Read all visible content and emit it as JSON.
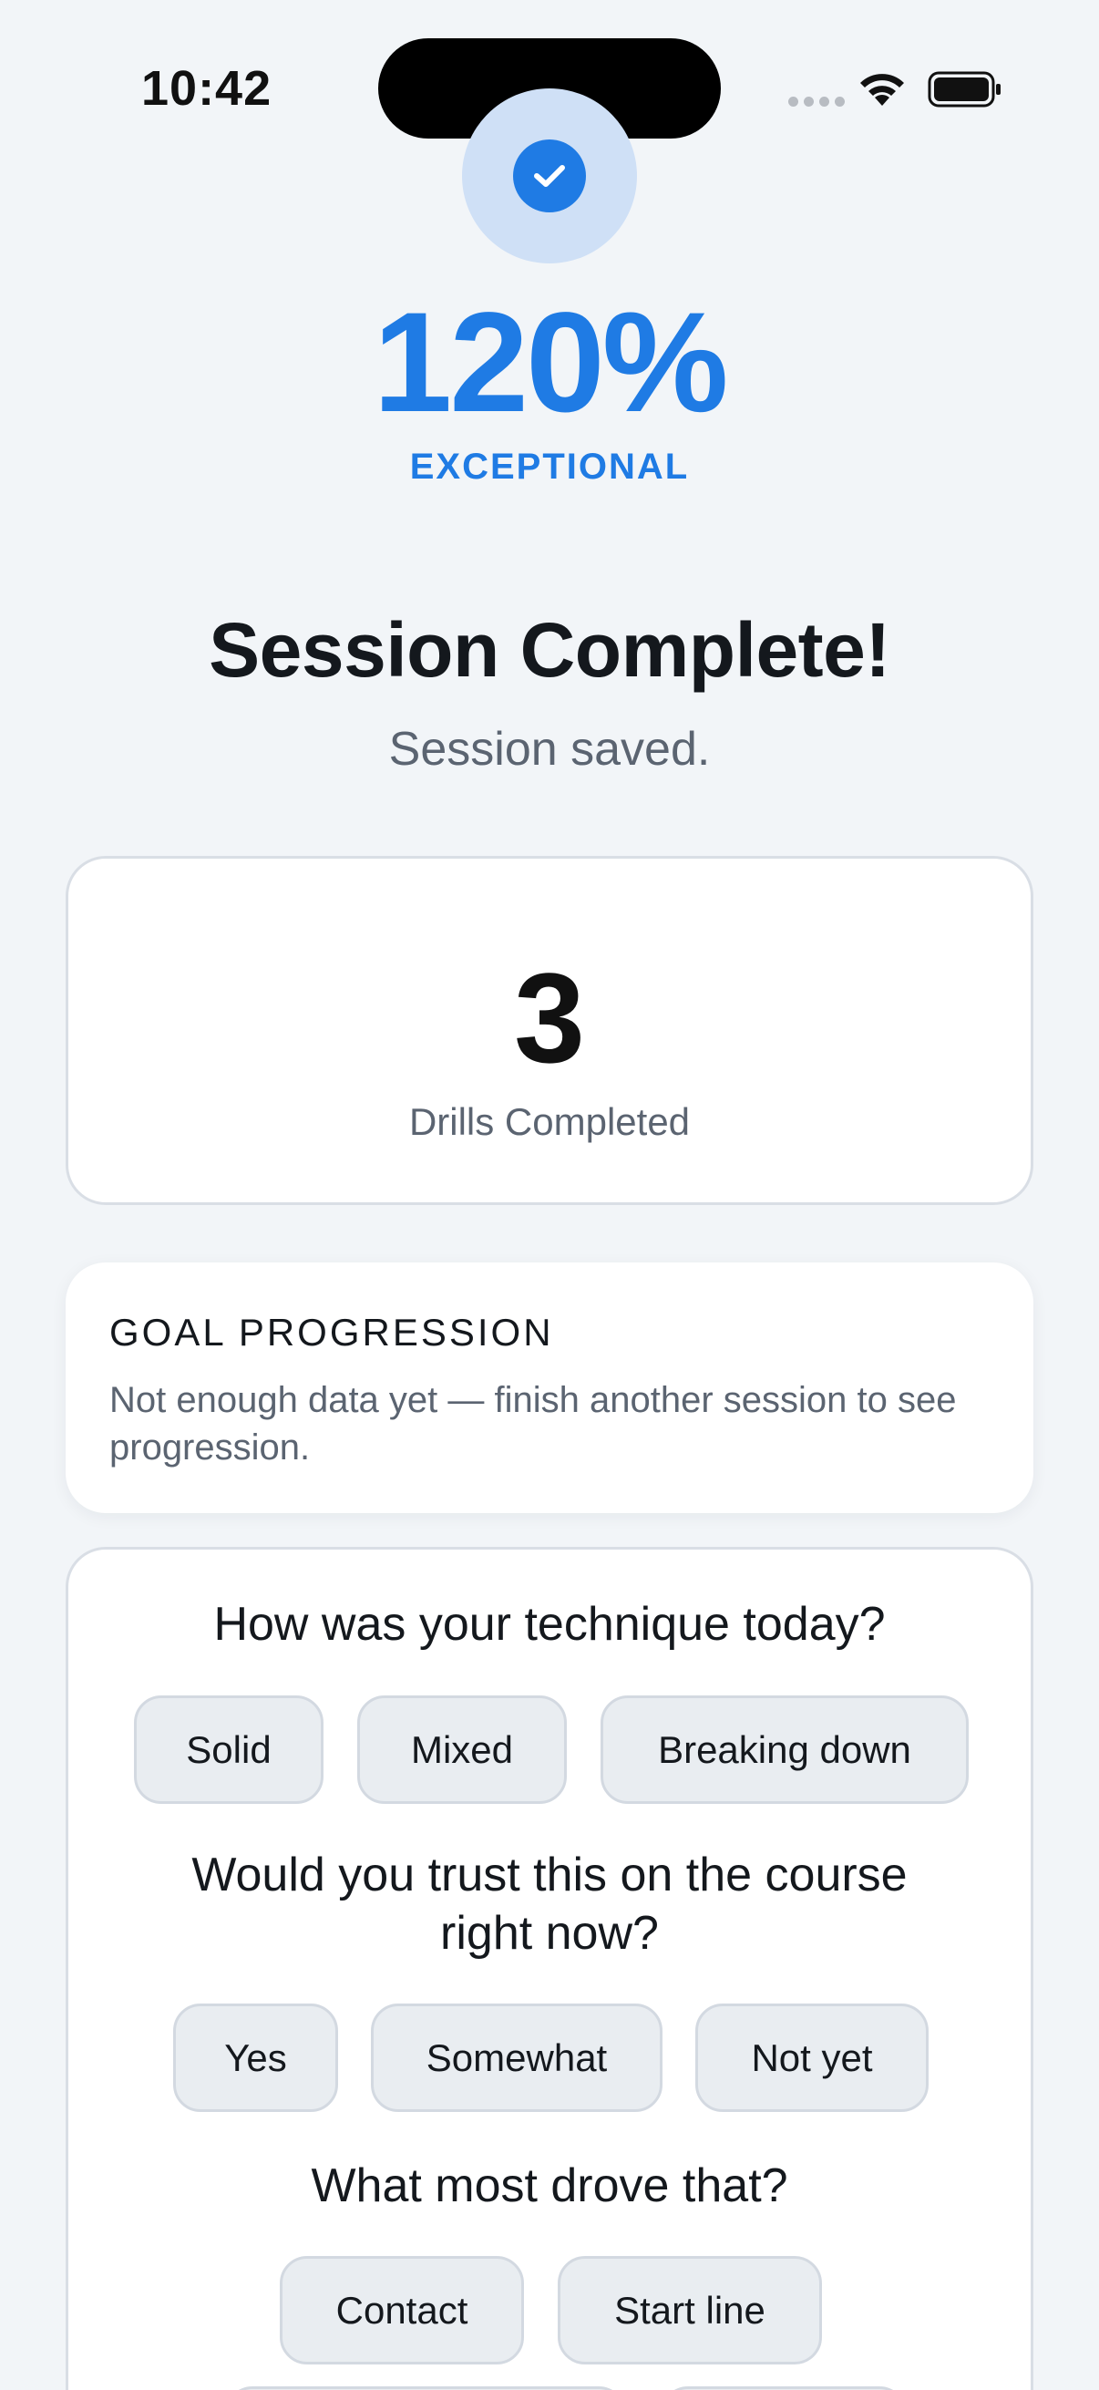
{
  "status_bar": {
    "time": "10:42"
  },
  "hero": {
    "score": "120%",
    "rating": "EXCEPTIONAL",
    "title": "Session Complete!",
    "subtitle": "Session saved."
  },
  "stat": {
    "value": "3",
    "label": "Drills Completed"
  },
  "goal": {
    "title": "GOAL PROGRESSION",
    "text": "Not enough data yet — finish another session to see progression."
  },
  "feedback": {
    "q1": {
      "question": "How was your technique today?",
      "options": [
        "Solid",
        "Mixed",
        "Breaking down"
      ]
    },
    "q2": {
      "question": "Would you trust this on the course right now?",
      "options": [
        "Yes",
        "Somewhat",
        "Not yet"
      ]
    },
    "q3": {
      "question": "What most drove that?",
      "options": [
        "Contact",
        "Start line"
      ]
    }
  },
  "colors": {
    "accent": "#1f7be4",
    "halo": "#cfe0f6",
    "background": "#f2f5f8",
    "chip": "#e9edf1"
  }
}
